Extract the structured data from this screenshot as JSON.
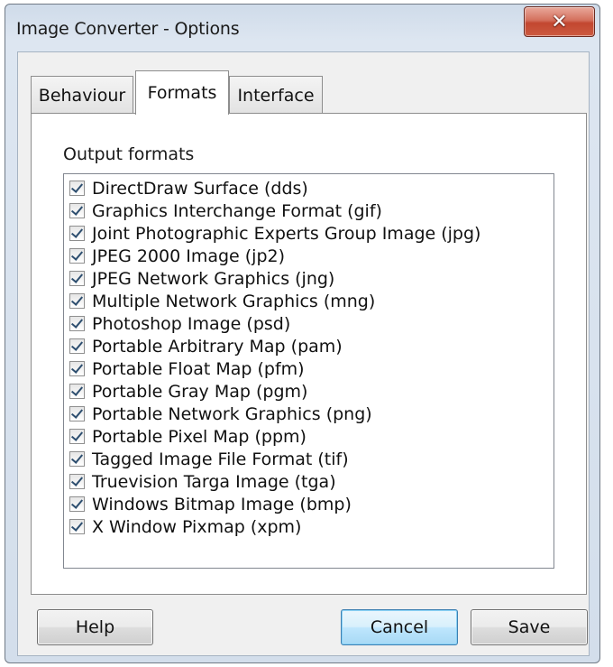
{
  "window": {
    "title": "Image Converter - Options",
    "close_glyph": "✕",
    "close_icon": "close-icon"
  },
  "tabs": [
    {
      "label": "Behaviour",
      "active": false
    },
    {
      "label": "Formats",
      "active": true
    },
    {
      "label": "Interface",
      "active": false
    }
  ],
  "formats": {
    "group_label": "Output formats",
    "items": [
      {
        "label": "DirectDraw Surface (dds)",
        "checked": true
      },
      {
        "label": "Graphics Interchange Format (gif)",
        "checked": true
      },
      {
        "label": "Joint Photographic Experts Group Image (jpg)",
        "checked": true
      },
      {
        "label": "JPEG 2000 Image (jp2)",
        "checked": true
      },
      {
        "label": "JPEG Network Graphics (jng)",
        "checked": true
      },
      {
        "label": "Multiple Network Graphics (mng)",
        "checked": true
      },
      {
        "label": "Photoshop Image (psd)",
        "checked": true
      },
      {
        "label": "Portable Arbitrary Map (pam)",
        "checked": true
      },
      {
        "label": "Portable Float Map (pfm)",
        "checked": true
      },
      {
        "label": "Portable Gray Map (pgm)",
        "checked": true
      },
      {
        "label": "Portable Network Graphics (png)",
        "checked": true
      },
      {
        "label": "Portable Pixel Map (ppm)",
        "checked": true
      },
      {
        "label": "Tagged Image File Format (tif)",
        "checked": true
      },
      {
        "label": "Truevision Targa Image (tga)",
        "checked": true
      },
      {
        "label": "Windows Bitmap Image (bmp)",
        "checked": true
      },
      {
        "label": "X Window Pixmap (xpm)",
        "checked": true
      }
    ]
  },
  "buttons": {
    "help": "Help",
    "cancel": "Cancel",
    "save": "Save"
  },
  "colors": {
    "close_button": "#c24730",
    "default_button_border": "#3c7fb1",
    "checkmark": "#2d4e6f"
  }
}
